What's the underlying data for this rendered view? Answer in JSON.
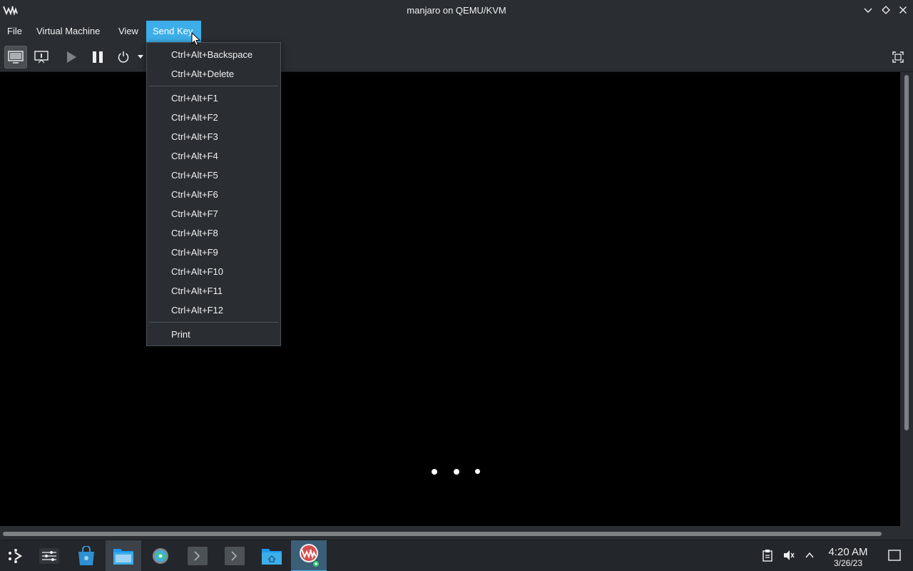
{
  "window": {
    "title": "manjaro on QEMU/KVM"
  },
  "menubar": {
    "items": [
      "File",
      "Virtual Machine",
      "View",
      "Send Key"
    ]
  },
  "send_key_menu": {
    "group1": [
      "Ctrl+Alt+Backspace",
      "Ctrl+Alt+Delete"
    ],
    "group2": [
      "Ctrl+Alt+F1",
      "Ctrl+Alt+F2",
      "Ctrl+Alt+F3",
      "Ctrl+Alt+F4",
      "Ctrl+Alt+F5",
      "Ctrl+Alt+F6",
      "Ctrl+Alt+F7",
      "Ctrl+Alt+F8",
      "Ctrl+Alt+F9",
      "Ctrl+Alt+F10",
      "Ctrl+Alt+F11",
      "Ctrl+Alt+F12"
    ],
    "group3": [
      "Print"
    ]
  },
  "toolbar": {
    "icons": [
      "console-icon",
      "details-icon",
      "run-icon",
      "pause-icon",
      "power-icon",
      "power-dropdown-icon",
      "fullscreen-icon"
    ]
  },
  "taskbar": {
    "icons": [
      "app-launcher-icon",
      "settings-sliders-icon",
      "store-icon",
      "file-manager-icon",
      "system-settings-icon",
      "terminal-icon",
      "terminal-icon",
      "home-folder-icon",
      "virt-manager-icon"
    ],
    "tray_icons": [
      "clipboard-icon",
      "volume-muted-icon",
      "chevron-up-icon",
      "show-desktop-icon"
    ],
    "clock_time": "4:20 AM",
    "clock_date": "3/26/23"
  },
  "colors": {
    "accent": "#3daee9",
    "chrome": "#2a2e32",
    "console_bg": "#000000"
  }
}
